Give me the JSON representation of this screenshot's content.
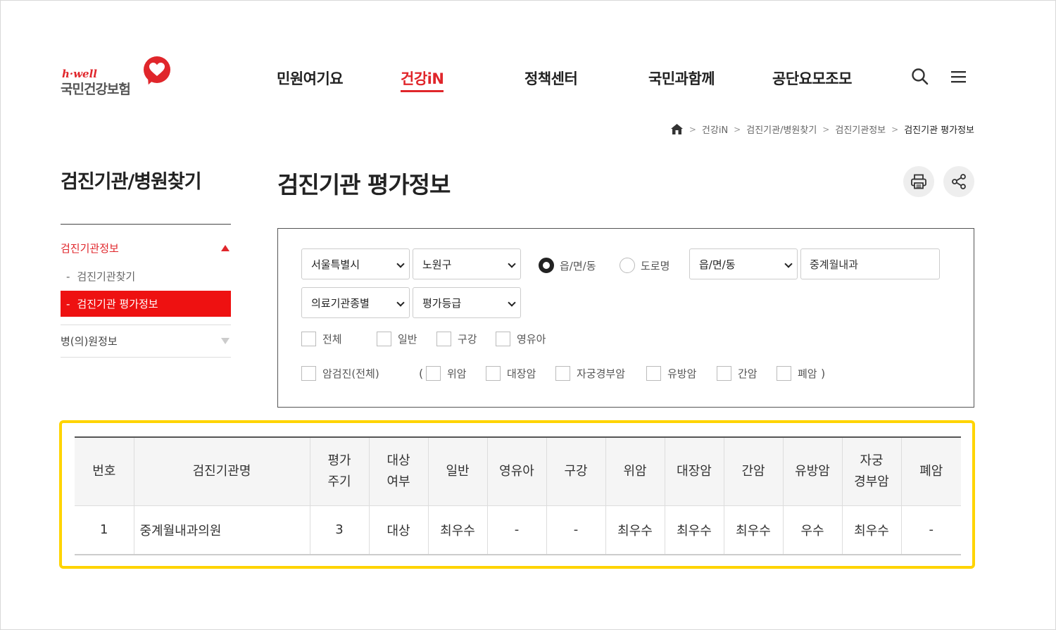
{
  "header": {
    "logo_brand": "h·well",
    "logo_name": "국민건강보험",
    "nav": [
      "민원여기요",
      "건강iN",
      "정책센터",
      "국민과함께",
      "공단요모조모"
    ],
    "active_nav_index": 1
  },
  "breadcrumb": [
    "건강iN",
    "검진기관/병원찾기",
    "검진기관정보",
    "검진기관 평가정보"
  ],
  "sidebar": {
    "title": "검진기관/병원찾기",
    "group1": "검진기관정보",
    "sub_items": [
      "검진기관찾기",
      "검진기관 평가정보"
    ],
    "group2": "병(의)원정보"
  },
  "page_title": "검진기관 평가정보",
  "search": {
    "sido": "서울특별시",
    "sigungu": "노원구",
    "radio_options": [
      "읍/면/동",
      "도로명"
    ],
    "radio_selected": "읍/면/동",
    "dong_select": "읍/면/동",
    "keyword": "중계월내과",
    "type_select": "의료기관종별",
    "grade_select": "평가등급",
    "checkboxes_row1": [
      "전체",
      "일반",
      "구강",
      "영유아"
    ],
    "checkbox_cancer_all": "암검진(전체)",
    "paren_open": "(",
    "checkboxes_cancer": [
      "위암",
      "대장암",
      "자궁경부암",
      "유방암",
      "간암",
      "폐암"
    ],
    "paren_close": ")"
  },
  "table": {
    "headers": [
      "번호",
      "검진기관명",
      "평가\n주기",
      "대상\n여부",
      "일반",
      "영유아",
      "구강",
      "위암",
      "대장암",
      "간암",
      "유방암",
      "자궁\n경부암",
      "폐암"
    ],
    "rows": [
      [
        "1",
        "중계월내과의원",
        "3",
        "대상",
        "최우수",
        "-",
        "-",
        "최우수",
        "최우수",
        "최우수",
        "우수",
        "최우수",
        "-"
      ]
    ]
  },
  "colors": {
    "accent_red": "#e0262b",
    "active_menu_bg": "#ee1111",
    "highlight_border": "#ffd400"
  },
  "icons": [
    "home-icon",
    "search-icon",
    "menu-icon",
    "print-icon",
    "share-icon",
    "heart-icon"
  ]
}
